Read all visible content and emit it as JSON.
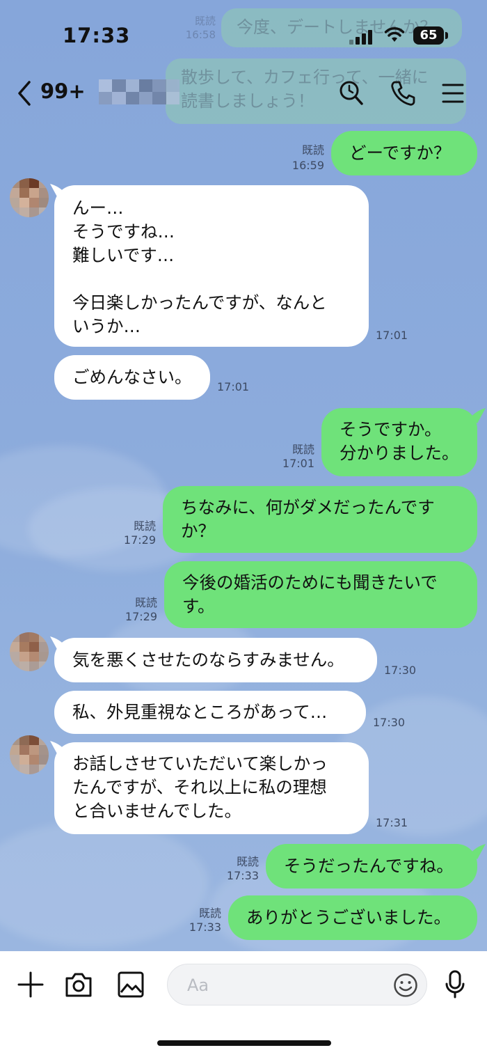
{
  "status_bar": {
    "time": "17:33",
    "battery": "65"
  },
  "header": {
    "back_count": "99+"
  },
  "faded_preview": [
    {
      "time": "16:58",
      "read": "既読",
      "text": "今度、デートしませんか？"
    },
    {
      "text": "散歩して、カフェ行って、一緒に\n読書しましょう！"
    }
  ],
  "messages": [
    {
      "side": "out",
      "text": "どーですか？",
      "read": "既読",
      "time": "16:59"
    },
    {
      "side": "in",
      "text": "んー…\nそうですね…\n難しいです…\n\n今日楽しかったんですが、なんと\nいうか…",
      "time": "17:01"
    },
    {
      "side": "in",
      "text": "ごめんなさい。",
      "time": "17:01"
    },
    {
      "side": "out",
      "text": "そうですか。\n分かりました。",
      "read": "既読",
      "time": "17:01"
    },
    {
      "side": "out",
      "text": "ちなみに、何がダメだったんです\nか？",
      "read": "既読",
      "time": "17:29"
    },
    {
      "side": "out",
      "text": "今後の婚活のためにも聞きたいで\nす。",
      "read": "既読",
      "time": "17:29"
    },
    {
      "side": "in",
      "text": "気を悪くさせたのならすみません。",
      "time": "17:30"
    },
    {
      "side": "in",
      "text": "私、外見重視なところがあって…",
      "time": "17:30"
    },
    {
      "side": "in",
      "text": "お話しさせていただいて楽しかっ\nたんですが、それ以上に私の理想\nと合いませんでした。",
      "time": "17:31"
    },
    {
      "side": "out",
      "text": "そうだったんですね。",
      "read": "既読",
      "time": "17:33"
    },
    {
      "side": "out",
      "text": "ありがとうございました。",
      "read": "既読",
      "time": "17:33"
    }
  ],
  "input": {
    "placeholder": "Aa"
  },
  "colors": {
    "background": "#8eacdb",
    "outgoing_bubble": "#6fe27a",
    "incoming_bubble": "#ffffff"
  },
  "icons": [
    "chevron-left-icon",
    "search-icon",
    "phone-icon",
    "menu-icon",
    "plus-icon",
    "camera-icon",
    "image-icon",
    "emoji-icon",
    "mic-icon"
  ]
}
